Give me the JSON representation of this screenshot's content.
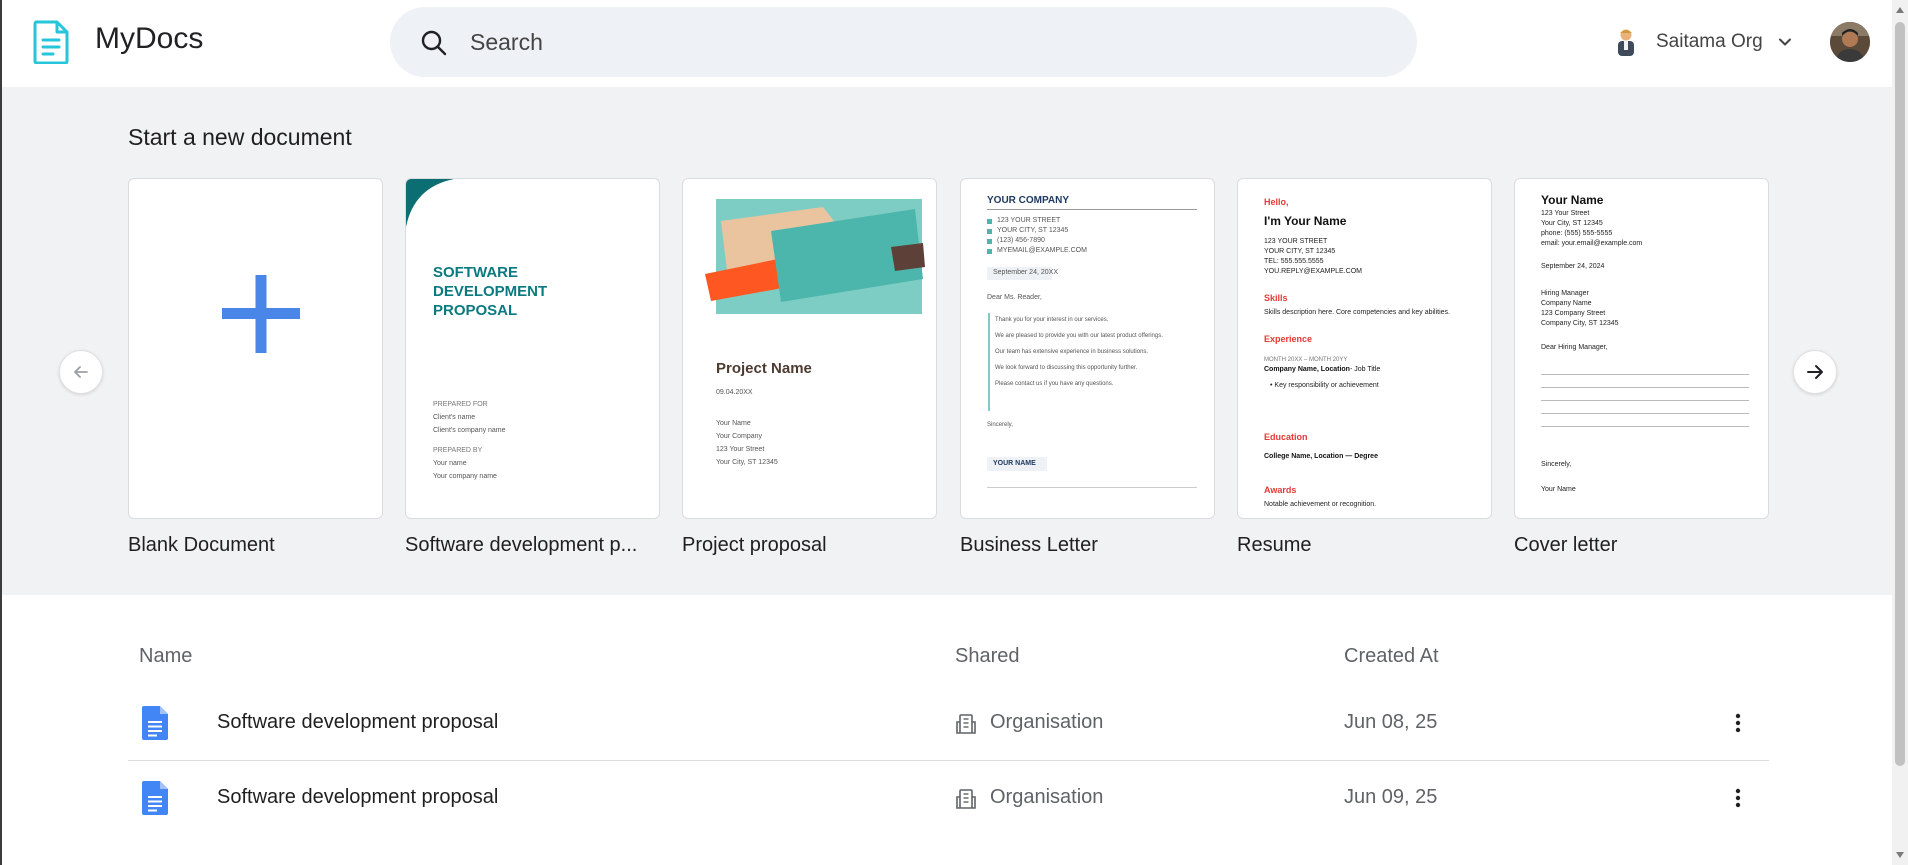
{
  "app": {
    "name": "MyDocs"
  },
  "search": {
    "placeholder": "Search"
  },
  "org": {
    "name": "Saitama Org"
  },
  "templates": {
    "title": "Start a new document",
    "items": [
      {
        "label": "Blank Document"
      },
      {
        "label": "Software development p...",
        "cover": {
          "title_lines": [
            "SOFTWARE",
            "DEVELOPMENT",
            "PROPOSAL"
          ],
          "prepared_for": "PREPARED FOR",
          "client_name": "Client's name",
          "client_company": "Client's company name",
          "prepared_by": "PREPARED BY",
          "your_name": "Your name",
          "your_company": "Your company name"
        }
      },
      {
        "label": "Project proposal",
        "cover": {
          "title": "Project Name",
          "date": "09.04.20XX",
          "lines": [
            "Your Name",
            "Your Company",
            "123 Your Street",
            "Your City, ST 12345"
          ]
        }
      },
      {
        "label": "Business Letter",
        "cover": {
          "company": "YOUR COMPANY",
          "contact": [
            "123 YOUR STREET",
            "YOUR CITY, ST 12345",
            "(123) 456-7890",
            "MYEMAIL@EXAMPLE.COM"
          ],
          "date": "September 24, 20XX",
          "greeting": "Dear Ms. Reader,",
          "body": [
            "Thank you for your interest in our services.",
            "We are pleased to provide you with our latest product offerings.",
            "Our team has extensive experience in business solutions.",
            "We look forward to discussing this opportunity further.",
            "Please contact us if you have any questions."
          ],
          "closing": "Sincerely,",
          "signature": "YOUR NAME"
        }
      },
      {
        "label": "Resume",
        "cover": {
          "hello": "Hello,",
          "name": "I'm Your Name",
          "contact": [
            "123 YOUR STREET",
            "YOUR CITY, ST 12345",
            "TEL: 555.555.5555",
            "YOU.REPLY@EXAMPLE.COM"
          ],
          "skills_h": "Skills",
          "skills": "Skills description here. Core competencies and key abilities.",
          "exp_h": "Experience",
          "exp_dates": "MONTH 20XX – MONTH 20YY",
          "exp_company": "Company Name, Location",
          "exp_title": "- Job Title",
          "exp_bullet": "Key responsibility or achievement",
          "edu_h": "Education",
          "edu": "College Name, Location — Degree",
          "awards_h": "Awards",
          "awards": "Notable achievement or recognition."
        }
      },
      {
        "label": "Cover letter",
        "cover": {
          "name": "Your Name",
          "contact": [
            "123 Your Street",
            "Your City, ST 12345",
            "phone: (555) 555-5555",
            "email: your.email@example.com"
          ],
          "date": "September 24, 2024",
          "recipient": [
            "Hiring Manager",
            "Company Name",
            "123 Company Street",
            "Company City, ST 12345"
          ],
          "greeting": "Dear Hiring Manager,",
          "closing": "Sincerely,",
          "signature": "Your Name"
        }
      }
    ]
  },
  "table": {
    "headers": {
      "name": "Name",
      "shared": "Shared",
      "created": "Created At"
    },
    "rows": [
      {
        "name": "Software development proposal",
        "shared": "Organisation",
        "created": "Jun 08, 25"
      },
      {
        "name": "Software development proposal",
        "shared": "Organisation",
        "created": "Jun 09, 25"
      }
    ]
  },
  "colors": {
    "accent": "#4285f4",
    "teal": "#0b6e72",
    "red": "#e53935",
    "background": "#f1f2f4"
  }
}
